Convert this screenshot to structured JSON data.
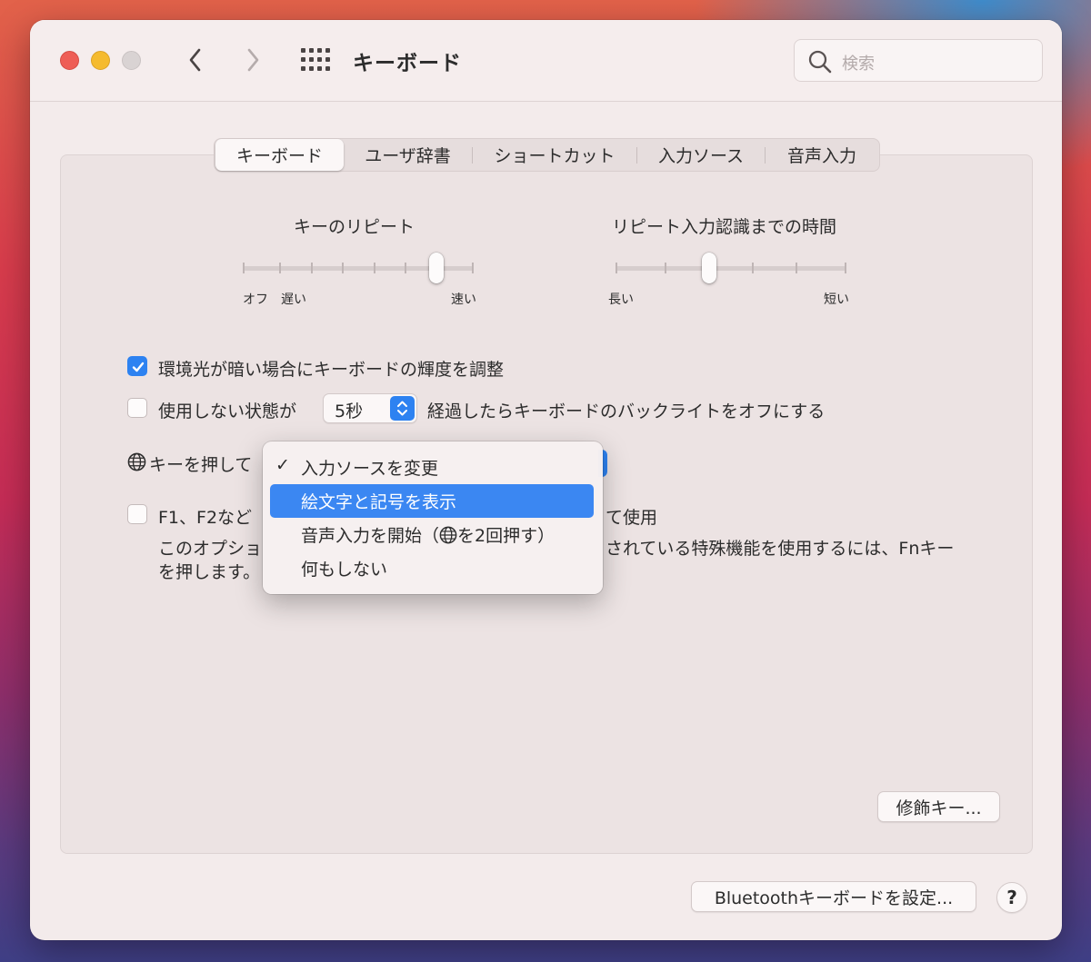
{
  "window": {
    "title": "キーボード"
  },
  "search": {
    "placeholder": "検索"
  },
  "tabs": [
    {
      "label": "キーボード",
      "active": true
    },
    {
      "label": "ユーザ辞書"
    },
    {
      "label": "ショートカット"
    },
    {
      "label": "入力ソース"
    },
    {
      "label": "音声入力"
    }
  ],
  "key_repeat": {
    "title": "キーのリピート",
    "labels": [
      "オフ",
      "遅い",
      "速い"
    ],
    "value_fraction": 0.85
  },
  "repeat_delay": {
    "title": "リピート入力認識までの時間",
    "labels": [
      "長い",
      "短い"
    ],
    "value_fraction": 0.4
  },
  "options": {
    "ambient_light": {
      "label": "環境光が暗い場合にキーボードの輝度を調整",
      "checked": true
    },
    "backlight_off": {
      "label_before": "使用しない状態が",
      "popup_value": "5秒",
      "label_after": "経過したらキーボードのバックライトをオフにする",
      "checked": false
    },
    "globe_key": {
      "label": "キーを押して"
    },
    "fn_keys": {
      "label_start": "F1、F2など",
      "label_end": "て使用",
      "desc1_start": "このオプショ",
      "desc1_end": "されている特殊機能を使用するには、Fnキー",
      "desc2_start": "を押します。",
      "checked": false
    }
  },
  "menu": {
    "items": [
      {
        "label": "入力ソースを変更",
        "checked": true
      },
      {
        "label": "絵文字と記号を表示",
        "highlighted": true
      },
      {
        "label_before": "音声入力を開始（",
        "label_after": "を2回押す）"
      },
      {
        "label": "何もしない"
      }
    ]
  },
  "buttons": {
    "modifier": "修飾キー...",
    "bluetooth": "Bluetoothキーボードを設定...",
    "help": "?"
  },
  "colors": {
    "accent": "#2d82f1",
    "highlight": "#3b87f2"
  }
}
